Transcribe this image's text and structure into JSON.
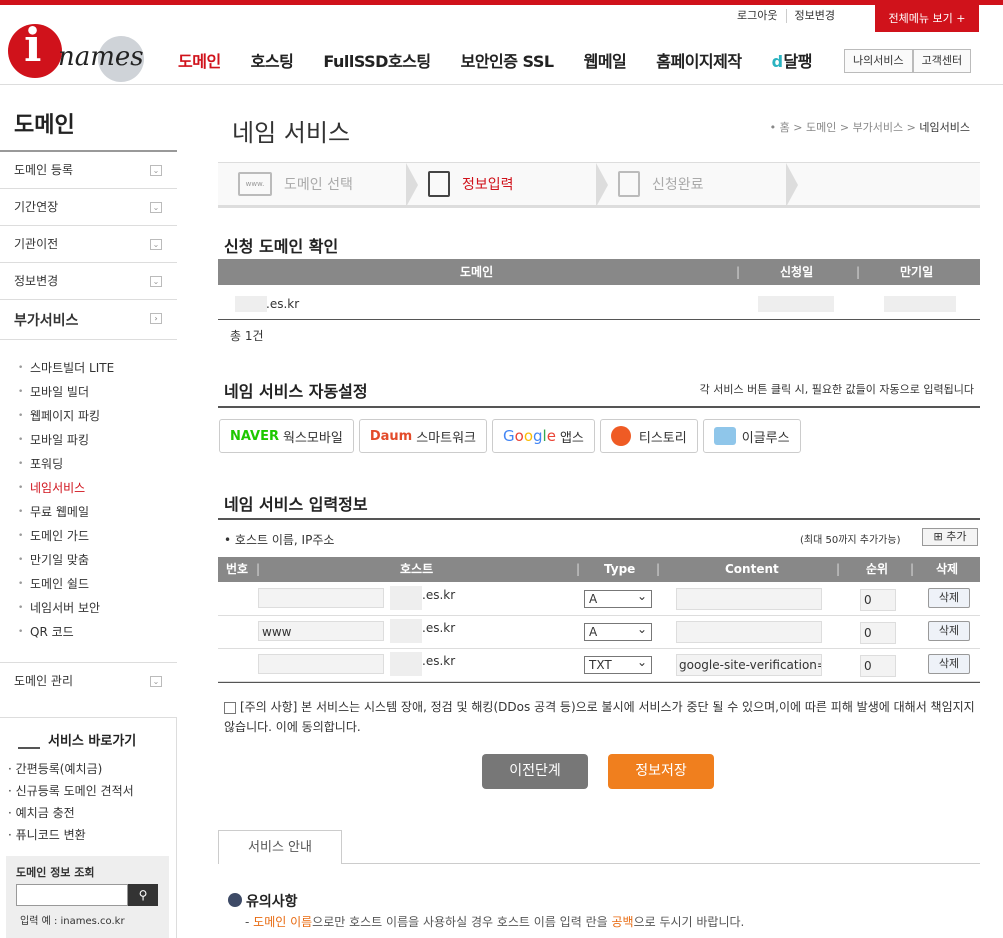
{
  "header": {
    "login": "로그아웃",
    "info_change": "정보변경",
    "all_menu": "전체메뉴 보기 +",
    "logo_text": "names",
    "nav": [
      "도메인",
      "호스팅",
      "FullSSD호스팅",
      "보안인증 SSL",
      "웹메일",
      "홈페이지제작",
      "달팽"
    ],
    "my_service": "나의서비스",
    "customer_center": "고객센터",
    "brand_color": "#d0121b"
  },
  "sidebar": {
    "title": "도메인",
    "items": [
      "도메인 등록",
      "기간연장",
      "기관이전",
      "정보변경"
    ],
    "addon_title": "부가서비스",
    "sub": [
      "스마트빌더 LITE",
      "모바일 빌더",
      "웹페이지 파킹",
      "모바일 파킹",
      "포워딩",
      "네임서비스",
      "무료 웹메일",
      "도메인 가드",
      "만기일 맞춤",
      "도메인 쉴드",
      "네임서버 보안",
      "QR 코드"
    ],
    "manage": "도메인 관리",
    "shortcut_title": "서비스 바로가기",
    "shortcuts": [
      "간편등록(예치금)",
      "신규등록 도메인 견적서",
      "예치금 충전",
      "퓨니코드 변환"
    ],
    "lookup_title": "도메인 정보 조회",
    "lookup_example": "입력 예 : inames.co.kr"
  },
  "main": {
    "title": "네임 서비스",
    "breadcrumb": [
      "홈",
      "도메인",
      "부가서비스",
      "네임서비스"
    ],
    "steps": [
      "도메인 선택",
      "정보입력",
      "신청완료"
    ],
    "confirm_title": "신청 도메인 확인",
    "confirm_headers": [
      "도메인",
      "신청일",
      "만기일"
    ],
    "confirm_domain": ".es.kr",
    "total": "총 1건",
    "auto_title": "네임 서비스 자동설정",
    "auto_note": "각 서비스 버튼 클릭 시, 필요한 값들이 자동으로 입력됩니다",
    "services": {
      "naver": "NAVER",
      "naver_label": "웍스모바일",
      "daum": "Daum",
      "daum_label": "스마트워크",
      "google_label": "앱스",
      "tistory": "티스토리",
      "eglus": "이글루스"
    },
    "input_title": "네임 서비스 입력정보",
    "host_label": "호스트 이름, IP주소",
    "max_note": "(최대 50까지 추가가능)",
    "add_button": "추가",
    "record_headers": [
      "번호",
      "호스트",
      "Type",
      "Content",
      "순위",
      "삭제"
    ],
    "records": [
      {
        "host": "",
        "domain": ".es.kr",
        "type": "A",
        "content": "",
        "rank": "0",
        "del": "삭제"
      },
      {
        "host": "www",
        "domain": ".es.kr",
        "type": "A",
        "content": "",
        "rank": "0",
        "del": "삭제"
      },
      {
        "host": "",
        "domain": ".es.kr",
        "type": "TXT",
        "content": "google-site-verification=k",
        "rank": "0",
        "del": "삭제"
      }
    ],
    "agree_bold": "[주의 사항]",
    "agree_text": " 본 서비스는 시스템 장애, 정검 및 해킹(DDos 공격 등)으로 불시에 서비스가 중단 될 수 있으며,이에 따른 피해 발생에 대해서 책임지지 않습니다. 이에 동의합니다.",
    "prev_button": "이전단계",
    "save_button": "정보저장",
    "guide_tab": "서비스 안내",
    "notice_title": "유의사항",
    "notice_line_a": "- ",
    "notice_line_b": "도메인 이름",
    "notice_line_c": "으로만 호스트 이름을 사용하실 경우 호스트 이름 입력 란을 ",
    "notice_line_d": "공백",
    "notice_line_e": "으로 두시기 바랍니다."
  }
}
